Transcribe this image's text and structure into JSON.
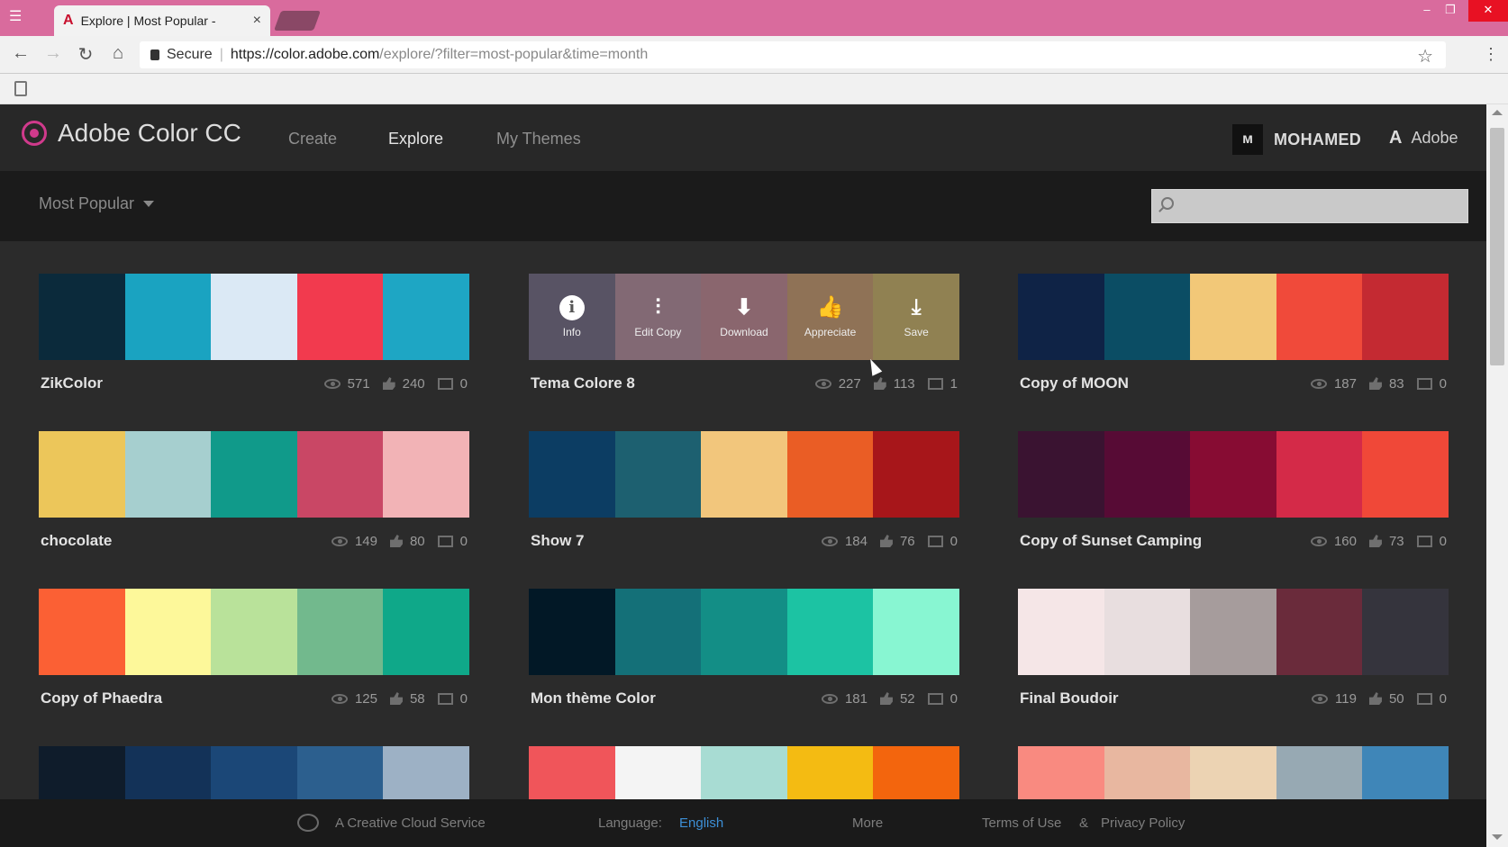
{
  "browser": {
    "tab_title": "Explore | Most Popular -",
    "secure_label": "Secure",
    "url_host": "https://color.adobe.com",
    "url_rest": "/explore/?filter=most-popular&time=month"
  },
  "app": {
    "brand": "Adobe Color CC",
    "nav": [
      "Create",
      "Explore",
      "My Themes"
    ],
    "active_nav": "Explore",
    "user": "MOHAMED",
    "adobe": "Adobe"
  },
  "filter": {
    "selected": "Most Popular",
    "search_placeholder": ""
  },
  "overlay_actions": [
    "Info",
    "Edit Copy",
    "Download",
    "Appreciate",
    "Save"
  ],
  "themes": [
    {
      "name": "ZikColor",
      "views": "571",
      "likes": "240",
      "comments": "0",
      "colors": [
        "#0b2a3b",
        "#1aa3c1",
        "#dbe9f5",
        "#f23a4e",
        "#1ea6c4"
      ]
    },
    {
      "name": "Tema Colore 8",
      "views": "227",
      "likes": "113",
      "comments": "1",
      "colors": [
        "#7b6f94",
        "#d8a0b8",
        "#e89aaa",
        "#f4b377",
        "#f6d56e"
      ]
    },
    {
      "name": "Copy of MOON",
      "views": "187",
      "likes": "83",
      "comments": "0",
      "colors": [
        "#0f2346",
        "#0b4d64",
        "#f2c878",
        "#f04a3a",
        "#c42a32"
      ]
    },
    {
      "name": "chocolate",
      "views": "149",
      "likes": "80",
      "comments": "0",
      "colors": [
        "#ecc65a",
        "#a6cfcf",
        "#109a8a",
        "#c94765",
        "#f2b3b6"
      ]
    },
    {
      "name": "Show 7",
      "views": "184",
      "likes": "76",
      "comments": "0",
      "colors": [
        "#0c3d63",
        "#1d6070",
        "#f2c67c",
        "#ea5d25",
        "#a7161a"
      ]
    },
    {
      "name": "Copy of Sunset Camping",
      "views": "160",
      "likes": "73",
      "comments": "0",
      "colors": [
        "#3a1331",
        "#570b35",
        "#870c33",
        "#d42a48",
        "#f04838"
      ]
    },
    {
      "name": "Copy of Phaedra",
      "views": "125",
      "likes": "58",
      "comments": "0",
      "colors": [
        "#fb6034",
        "#fdf89a",
        "#b9e29a",
        "#72b98d",
        "#0fa889"
      ]
    },
    {
      "name": "Mon thème Color",
      "views": "181",
      "likes": "52",
      "comments": "0",
      "colors": [
        "#021826",
        "#147078",
        "#138e86",
        "#1cc3a3",
        "#88f6d2"
      ]
    },
    {
      "name": "Final Boudoir",
      "views": "119",
      "likes": "50",
      "comments": "0",
      "colors": [
        "#f5e6e7",
        "#e8dedf",
        "#a69c9c",
        "#6a2b3b",
        "#35343d"
      ]
    },
    {
      "name": "",
      "views": "",
      "likes": "",
      "comments": "",
      "colors": [
        "#0f1c2b",
        "#133258",
        "#1b4777",
        "#2c5f8e",
        "#9db1c5"
      ]
    },
    {
      "name": "",
      "views": "",
      "likes": "",
      "comments": "",
      "colors": [
        "#f0555a",
        "#f4f4f4",
        "#a8dcd3",
        "#f4bb12",
        "#f3650d"
      ]
    },
    {
      "name": "",
      "views": "",
      "likes": "",
      "comments": "",
      "colors": [
        "#f98a80",
        "#e8b7a0",
        "#ecd3b3",
        "#97a9b3",
        "#3f86b8"
      ]
    }
  ],
  "footer": {
    "service": "A Creative Cloud Service",
    "language_label": "Language:",
    "language_value": "English",
    "more": "More",
    "terms": "Terms of Use",
    "separator": "&",
    "privacy": "Privacy Policy"
  }
}
